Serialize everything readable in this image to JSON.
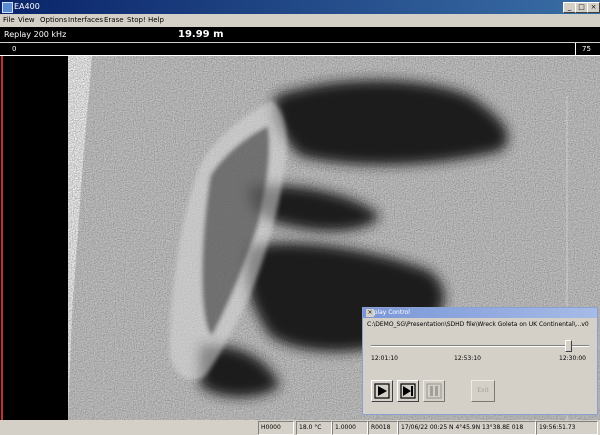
{
  "window": {
    "title": "EA400"
  },
  "menu": [
    "File",
    "View",
    "Options",
    "Interfaces",
    "Erase",
    "Stop!",
    "Help"
  ],
  "status": {
    "mode": "Replay 200 kHz",
    "range": "19.99 m"
  },
  "ruler": {
    "left": "0",
    "right": "75"
  },
  "dialog": {
    "title": "Replay Control",
    "path": "C:\\DEMO_SG\\Presentation\\SDHD file\\Wreck Goleta on UK Continental\\...v0",
    "start_time": "12:01:10",
    "mid_time": "12:53:10",
    "end_time": "12:30:00",
    "position_fraction": 0.92,
    "buttons": {
      "play": "play-icon",
      "step": "step-icon",
      "pause": "pause-icon",
      "exit": "Exit"
    }
  },
  "bottom": [
    "H0000",
    "18.0 °C",
    "1.0000",
    "R0018",
    "17/06/22 00:25 N 4°45.9N 13°38.8E 018",
    "19:56:51.73"
  ],
  "colors": {
    "accent": "#0a246a",
    "sonar_bg": "#000000"
  }
}
